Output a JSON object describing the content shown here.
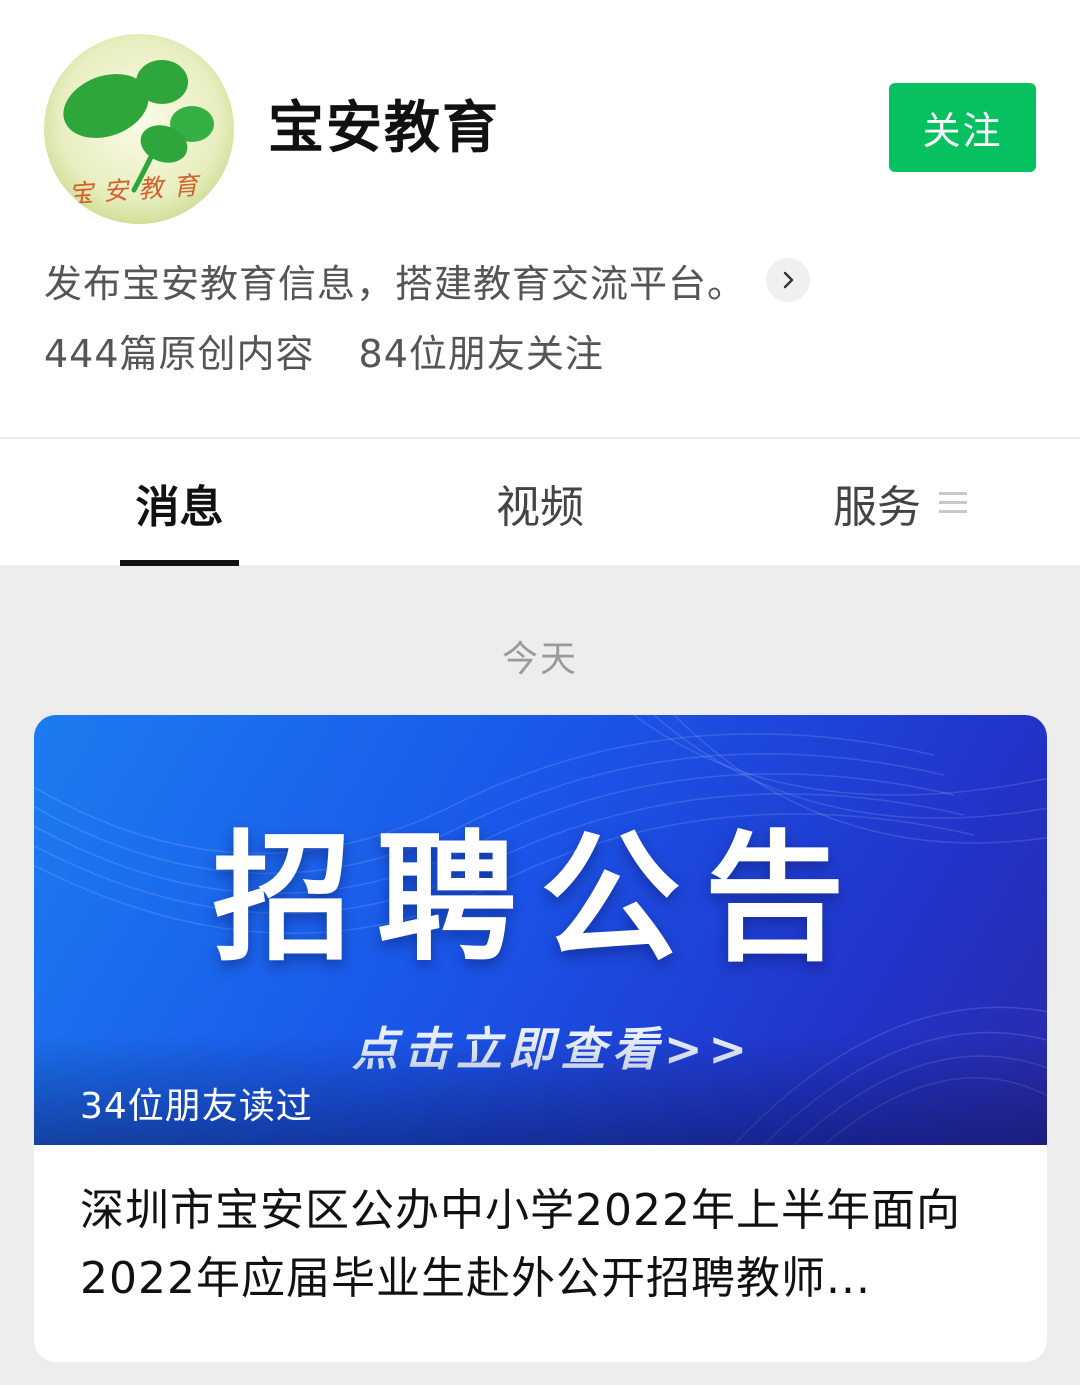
{
  "profile": {
    "logo_text": "宝安教育",
    "account_name": "宝安教育",
    "follow_label": "关注",
    "description": "发布宝安教育信息，搭建教育交流平台。",
    "stats": {
      "original_content": "444篇原创内容",
      "friends_following": "84位朋友关注"
    }
  },
  "tabs": [
    {
      "label": "消息",
      "active": true
    },
    {
      "label": "视频",
      "active": false
    },
    {
      "label": "服务",
      "active": false
    }
  ],
  "feed": {
    "date_label": "今天",
    "articles": [
      {
        "cover_title": "招聘公告",
        "cover_cta": "点击立即查看>>",
        "read_count": "34位朋友读过",
        "title": "深圳市宝安区公办中小学2022年上半年面向2022年应届毕业生赴外公开招聘教师..."
      }
    ]
  },
  "colors": {
    "follow_button": "#07c160",
    "page_background": "#ededed",
    "cover_gradient_start": "#1c7cf0",
    "cover_gradient_end": "#2a2aaa"
  },
  "icons": {
    "description_expand": "chevron-right-icon",
    "service_menu": "menu-icon"
  }
}
